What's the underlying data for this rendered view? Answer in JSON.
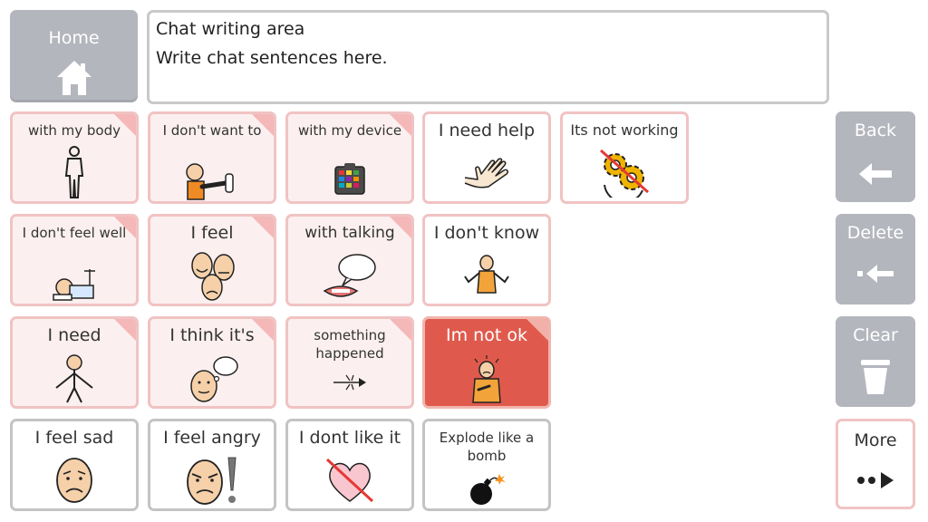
{
  "home": {
    "label": "Home"
  },
  "chat": {
    "title": "Chat writing area",
    "placeholder": "Write chat sentences here."
  },
  "tiles": {
    "with_my_body": "with my body",
    "i_dont_want_to": "I don't want to",
    "with_my_device": "with my device",
    "i_need_help": "I need help",
    "its_not_working": "Its not working",
    "i_dont_feel_well": "I don't feel well",
    "i_feel": "I feel",
    "with_talking": "with talking",
    "i_dont_know": "I don't know",
    "i_need": "I need",
    "i_think_its": "I think it's",
    "something_happened": "something happened",
    "im_not_ok": "Im not ok",
    "i_feel_sad": "I feel sad",
    "i_feel_angry": "I feel angry",
    "i_dont_like_it": "I dont like it",
    "explode_like_a_bomb": "Explode like a bomb"
  },
  "side": {
    "back": "Back",
    "delete": "Delete",
    "clear": "Clear",
    "more": "More"
  },
  "colors": {
    "gray_button": "#b4b6bd",
    "tile_border": "#f1c3c3",
    "tile_fill": "#fbf0ef",
    "alert_tile": "#df5a4d"
  }
}
